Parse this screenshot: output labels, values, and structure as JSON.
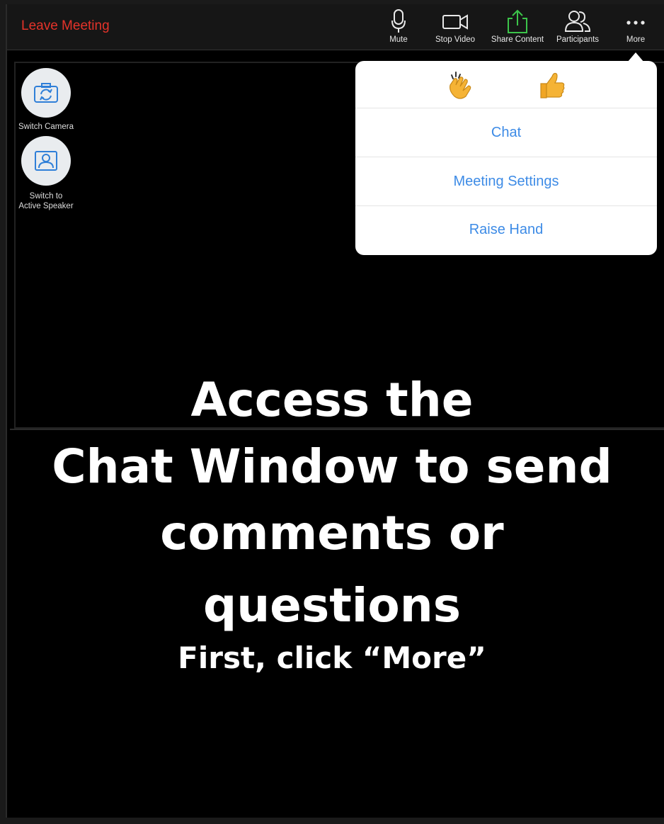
{
  "toolbar": {
    "leave_label": "Leave Meeting",
    "items": [
      {
        "label": "Mute",
        "icon": "microphone-icon"
      },
      {
        "label": "Stop Video",
        "icon": "video-camera-icon"
      },
      {
        "label": "Share Content",
        "icon": "share-upload-icon",
        "color": "#3cc44a"
      },
      {
        "label": "Participants",
        "icon": "participants-icon"
      },
      {
        "label": "More",
        "icon": "more-dots-icon"
      }
    ]
  },
  "side_controls": {
    "switch_camera": "Switch Camera",
    "switch_speaker_line1": "Switch to",
    "switch_speaker_line2": "Active Speaker"
  },
  "more_menu": {
    "reactions": [
      "clapping-hands-icon",
      "thumbs-up-icon"
    ],
    "items": [
      "Chat",
      "Meeting Settings",
      "Raise Hand"
    ]
  },
  "caption": {
    "line1": "Access the",
    "line2": "Chat Window to send",
    "line3": "comments or",
    "line4": "questions",
    "line5": "First, click “More”"
  },
  "colors": {
    "leave": "#e5332a",
    "menu_link": "#3d8be6",
    "share_green": "#3cc44a"
  }
}
